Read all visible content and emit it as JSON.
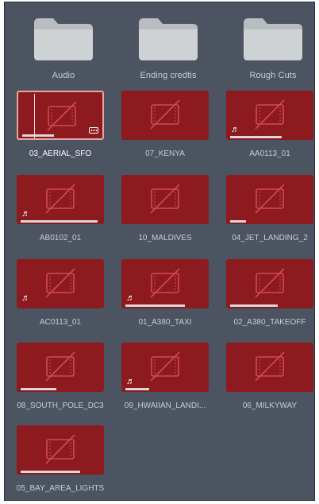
{
  "folders": [
    {
      "name": "Audio"
    },
    {
      "name": "Ending credtis"
    },
    {
      "name": "Rough Cuts"
    }
  ],
  "clips": [
    {
      "name": "03_AERIAL_SFO",
      "selected": true,
      "audio": false,
      "more": true,
      "progress": 0.4
    },
    {
      "name": "07_KENYA",
      "selected": false,
      "audio": false,
      "more": false,
      "progress": 0
    },
    {
      "name": "AA0113_01",
      "selected": false,
      "audio": true,
      "more": false,
      "progress": 0.65
    },
    {
      "name": "AB0102_01",
      "selected": false,
      "audio": true,
      "more": false,
      "progress": 0.97
    },
    {
      "name": "10_MALDIVES",
      "selected": false,
      "audio": false,
      "more": false,
      "progress": 0
    },
    {
      "name": "04_JET_LANDING_2",
      "selected": false,
      "audio": false,
      "more": false,
      "progress": 0.2
    },
    {
      "name": "AC0113_01",
      "selected": false,
      "audio": true,
      "more": false,
      "progress": 0
    },
    {
      "name": "01_A380_TAXI",
      "selected": false,
      "audio": true,
      "more": false,
      "progress": 0.75
    },
    {
      "name": "02_A380_TAKEOFF",
      "selected": false,
      "audio": false,
      "more": false,
      "progress": 0.6
    },
    {
      "name": "08_SOUTH_POLE_DC3",
      "selected": false,
      "audio": false,
      "more": false,
      "progress": 0.45
    },
    {
      "name": "09_HWAIIAN_LANDI...",
      "selected": false,
      "audio": true,
      "more": false,
      "progress": 0.3
    },
    {
      "name": "06_MILKYWAY",
      "selected": false,
      "audio": false,
      "more": false,
      "progress": 0
    },
    {
      "name": "05_BAY_AREA_LIGHTS",
      "selected": false,
      "audio": false,
      "more": false,
      "progress": 0.75
    }
  ],
  "icons": {
    "folder": "folder-icon",
    "clip": "film-offline-icon",
    "audio": "music-note-icon",
    "more": "more-options-icon"
  },
  "colors": {
    "panel_bg": "#4b5460",
    "thumb_bg": "#8c1a1f",
    "thumb_icon": "#d34a51",
    "label_text": "#c7cdd4",
    "selected_border": "#e9a3a6"
  }
}
